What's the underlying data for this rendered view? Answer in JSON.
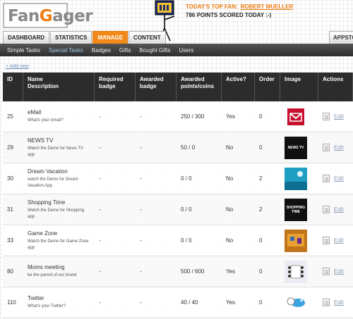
{
  "header": {
    "logo_part1": "Fan",
    "logo_part2": "G",
    "logo_part3": "ager",
    "top_fan_label": "TODAY'S TOP FAN:",
    "top_fan_name": "ROBERT MUELLER",
    "points_text": "786 POINTS SCORED TODAY :-)"
  },
  "tabs": [
    {
      "label": "DASHBOARD",
      "active": false
    },
    {
      "label": "STATISTICS",
      "active": false
    },
    {
      "label": "MANAGE",
      "active": true
    },
    {
      "label": "CONTENT",
      "active": false
    }
  ],
  "tab_right": "APPSTO",
  "subnav": [
    {
      "label": "Simple Tasks",
      "active": false
    },
    {
      "label": "Special Tasks",
      "active": true
    },
    {
      "label": "Badges",
      "active": false
    },
    {
      "label": "Gifts",
      "active": false
    },
    {
      "label": "Bought Gifts",
      "active": false
    },
    {
      "label": "Users",
      "active": false
    }
  ],
  "add_new": "+ Add new",
  "table": {
    "headers": {
      "id": "ID",
      "name": "Name",
      "description": "Description",
      "required": "Required badge",
      "awarded": "Awarded badge",
      "points": "Awarded points/coins",
      "active": "Active?",
      "order": "Order",
      "image": "Image",
      "actions": "Actions"
    },
    "edit_label": "Edit",
    "rows": [
      {
        "id": "25",
        "name": "eMail",
        "desc": "What's your email?",
        "required": "-",
        "awarded": "-",
        "points": "250 / 300",
        "active": "Yes",
        "order": "0",
        "thumb_bg": "#ffffff",
        "thumb_text": "",
        "thumb_kind": "email"
      },
      {
        "id": "29",
        "name": "NEWS TV",
        "desc": "Watch the Demo for News TV app",
        "required": "-",
        "awarded": "-",
        "points": "50 / 0",
        "active": "No",
        "order": "0",
        "thumb_bg": "#111111",
        "thumb_text": "NEWS TV",
        "thumb_kind": "news"
      },
      {
        "id": "30",
        "name": "Dream Vacation",
        "desc": "watch the Demo for Dream Vacation App",
        "required": "-",
        "awarded": "-",
        "points": "0 / 0",
        "active": "No",
        "order": "2",
        "thumb_bg": "#1a8fb0",
        "thumb_text": "",
        "thumb_kind": "vacation"
      },
      {
        "id": "31",
        "name": "Shopping Time",
        "desc": "Watch the Demo for Shopping app",
        "required": "-",
        "awarded": "-",
        "points": "0 / 0",
        "active": "No",
        "order": "2",
        "thumb_bg": "#111111",
        "thumb_text": "SHOPPING TIME",
        "thumb_kind": "shop"
      },
      {
        "id": "33",
        "name": "Game Zone",
        "desc": "Watch the Demo for Game Zone app",
        "required": "-",
        "awarded": "-",
        "points": "0 / 0",
        "active": "No",
        "order": "0",
        "thumb_bg": "#c0751a",
        "thumb_text": "",
        "thumb_kind": "game"
      },
      {
        "id": "80",
        "name": "Moms meeting",
        "desc": "be the parent of our brand",
        "required": "-",
        "awarded": "-",
        "points": "500 / 600",
        "active": "Yes",
        "order": "0",
        "thumb_bg": "#e9e9ef",
        "thumb_text": "",
        "thumb_kind": "meeting"
      },
      {
        "id": "110",
        "name": "Twitter",
        "desc": "What's your Twitter?",
        "required": "-",
        "awarded": "-",
        "points": "40 / 40",
        "active": "Yes",
        "order": "0",
        "thumb_bg": "#ffffff",
        "thumb_text": "",
        "thumb_kind": "twitter"
      }
    ]
  }
}
